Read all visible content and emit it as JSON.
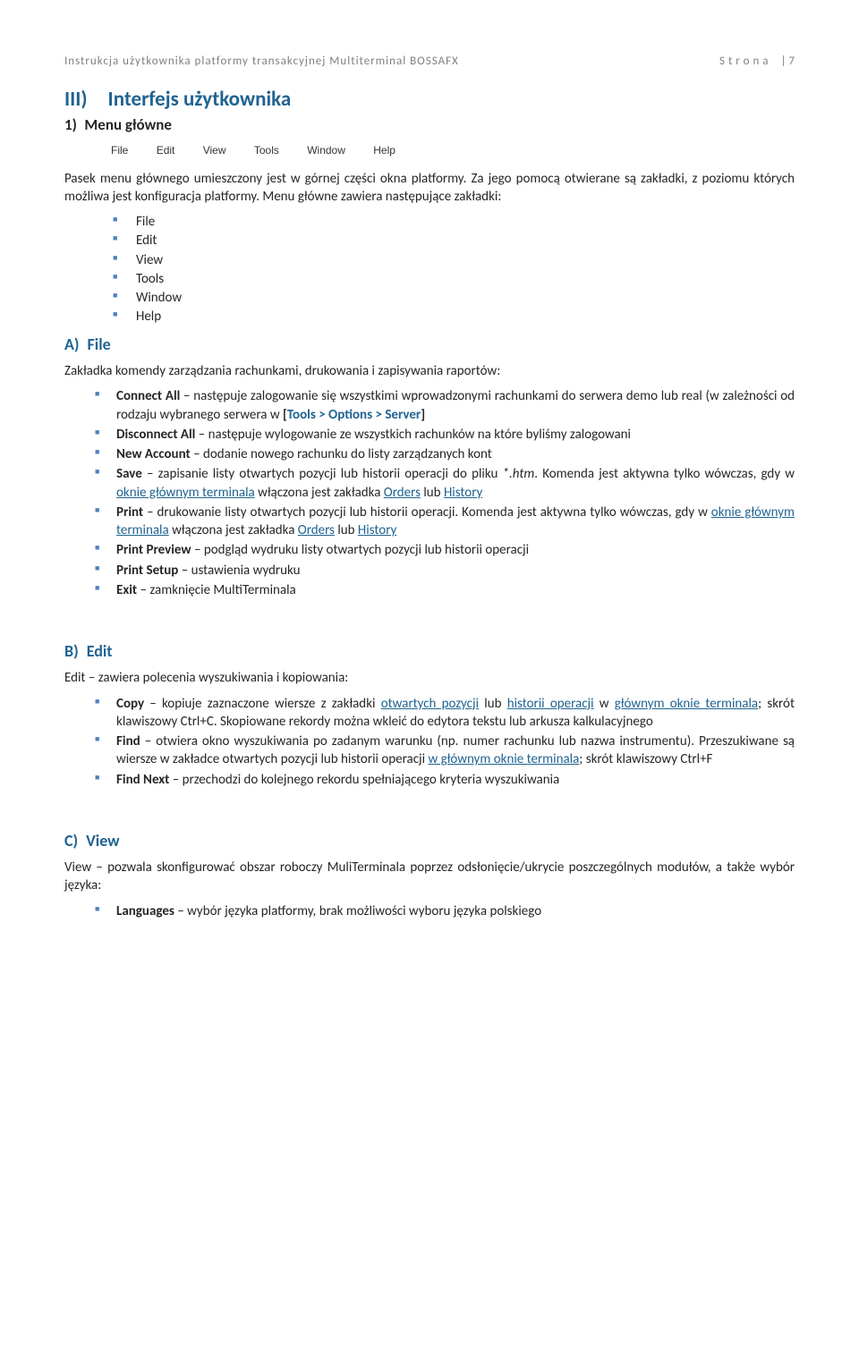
{
  "header": {
    "left": "Instrukcja użytkownika platformy transakcyjnej Multiterminal BOSSAFX",
    "right_label": "Strona",
    "right_sep": "|",
    "right_num": "7"
  },
  "h_roman": "III) Interfejs użytkownika",
  "h_sub1": "1) Menu główne",
  "menubar": {
    "file": "File",
    "edit": "Edit",
    "view": "View",
    "tools": "Tools",
    "window": "Window",
    "help": "Help"
  },
  "p1": "Pasek menu głównego umieszczony jest w górnej części okna platformy. Za jego pomocą otwierane są zakładki, z poziomu których możliwa jest konfiguracja platformy. Menu główne zawiera następujące zakładki:",
  "menuitems": {
    "i0": "File",
    "i1": "Edit",
    "i2": "View",
    "i3": "Tools",
    "i4": "Window",
    "i5": "Help"
  },
  "h_A": "A) File",
  "p2": "Zakładka komendy zarządzania rachunkami, drukowania i zapisywania raportów:",
  "file": {
    "connect_b": "Connect All",
    "connect_rest": " – następuje zalogowanie się wszystkimi wprowadzonymi rachunkami do serwera demo lub real (w zależności od rodzaju wybranego serwera w ",
    "tools_lbracket": "[",
    "tools_ref": "Tools > Options > Server",
    "tools_rbracket": "]",
    "disconnect_b": "Disconnect All",
    "disconnect_rest": " – następuje wylogowanie ze wszystkich rachunków na które byliśmy zalogowani",
    "newacc_b": "New Account",
    "newacc_rest": " – dodanie nowego rachunku do listy zarządzanych kont",
    "save_b": "Save",
    "save_rest1": " – zapisanie listy otwartych pozycji lub historii operacji do pliku ",
    "save_ext": "*.htm",
    "save_rest2": ". Komenda jest aktywna tylko wówczas, gdy w ",
    "link_okno": "oknie głównym terminala",
    "save_rest3": " włączona jest zakładka ",
    "link_orders": "Orders",
    "save_or": " lub ",
    "link_history": "History",
    "print_b": "Print",
    "print_rest1": " – drukowanie listy otwartych pozycji lub historii operacji. Komenda jest aktywna tylko wówczas, gdy w ",
    "print_rest2": " włączona jest zakładka ",
    "printprev_b": "Print Preview",
    "printprev_rest": " – podgląd wydruku listy otwartych pozycji lub historii operacji",
    "printset_b": "Print Setup",
    "printset_rest": " – ustawienia wydruku",
    "exit_b": "Exit",
    "exit_rest": " – zamknięcie MultiTerminala"
  },
  "h_B": "B) Edit",
  "p3": "Edit – zawiera polecenia wyszukiwania i kopiowania:",
  "edit": {
    "copy_b": "Copy",
    "copy_rest1": " – kopiuje zaznaczone wiersze z zakładki ",
    "link_otwartych": "otwartych pozycji",
    "copy_or": " lub ",
    "link_histop": "historii operacji",
    "copy_in": " w ",
    "link_glownym": "głównym oknie terminala",
    "copy_rest2": "; skrót klawiszowy Ctrl+C. Skopiowane rekordy można wkleić do edytora tekstu lub arkusza kalkulacyjnego",
    "find_b": "Find",
    "find_rest1": " – otwiera okno wyszukiwania po zadanym warunku (np. numer rachunku lub nazwa instrumentu). Przeszukiwane są wiersze w zakładce otwartych pozycji lub historii operacji ",
    "link_wglownym": "w głównym oknie terminala",
    "find_rest2": "; skrót klawiszowy Ctrl+F",
    "findnext_b": "Find Next",
    "findnext_rest": " – przechodzi do kolejnego rekordu spełniającego kryteria wyszukiwania"
  },
  "h_C": "C) View",
  "p4": "View – pozwala skonfigurować obszar roboczy MuliTerminala poprzez odsłonięcie/ukrycie poszczególnych modułów, a także wybór języka:",
  "view": {
    "lang_b": "Languages",
    "lang_rest": " – wybór języka platformy, brak możliwości wyboru języka polskiego"
  }
}
